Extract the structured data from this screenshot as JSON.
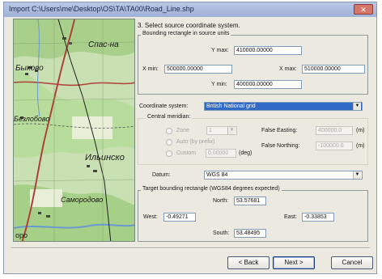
{
  "window": {
    "title": "Import C:\\Users\\me\\Desktop\\OS\\TA\\TA00\\Road_Line.shp",
    "close_glyph": "✕"
  },
  "map": {
    "labels": [
      "Спас-на",
      "Быково",
      "Безлобово",
      "Ильинско",
      "Самородово",
      "оро"
    ]
  },
  "step": "3. Select source coordinate system.",
  "bounding": {
    "legend": "Bounding rectangle in source units",
    "ymax_label": "Y max:",
    "ymax": "410000.00000",
    "xmin_label": "X min:",
    "xmin": "500000.00000",
    "xmax_label": "X max:",
    "xmax": "510000.00000",
    "ymin_label": "Y min:",
    "ymin": "400000.00000"
  },
  "coord": {
    "label": "Coordinate system:",
    "value": "British National grid"
  },
  "central_meridian": {
    "legend": "Central meridian:",
    "zone_label": "Zone",
    "zone_value": "1",
    "auto_label": "Auto (by prefix)",
    "custom_label": "Custom",
    "custom_value": "0.00000",
    "custom_unit": "(deg)",
    "false_easting_label": "False Easting:",
    "false_easting": "400000.0",
    "easting_unit": "(m)",
    "false_northing_label": "False Northing:",
    "false_northing": "-100000.0",
    "northing_unit": "(m)"
  },
  "datum": {
    "label": "Datum:",
    "value": "WGS 84"
  },
  "target": {
    "legend": "Target bounding rectangle (WGS84 degrees expected)",
    "north_label": "North:",
    "north": "53.57681",
    "west_label": "West:",
    "west": "-0.49271",
    "east_label": "East:",
    "east": "-0.33853",
    "south_label": "South:",
    "south": "53.48495"
  },
  "buttons": {
    "back": "< Back",
    "next": "Next >",
    "cancel": "Cancel"
  }
}
